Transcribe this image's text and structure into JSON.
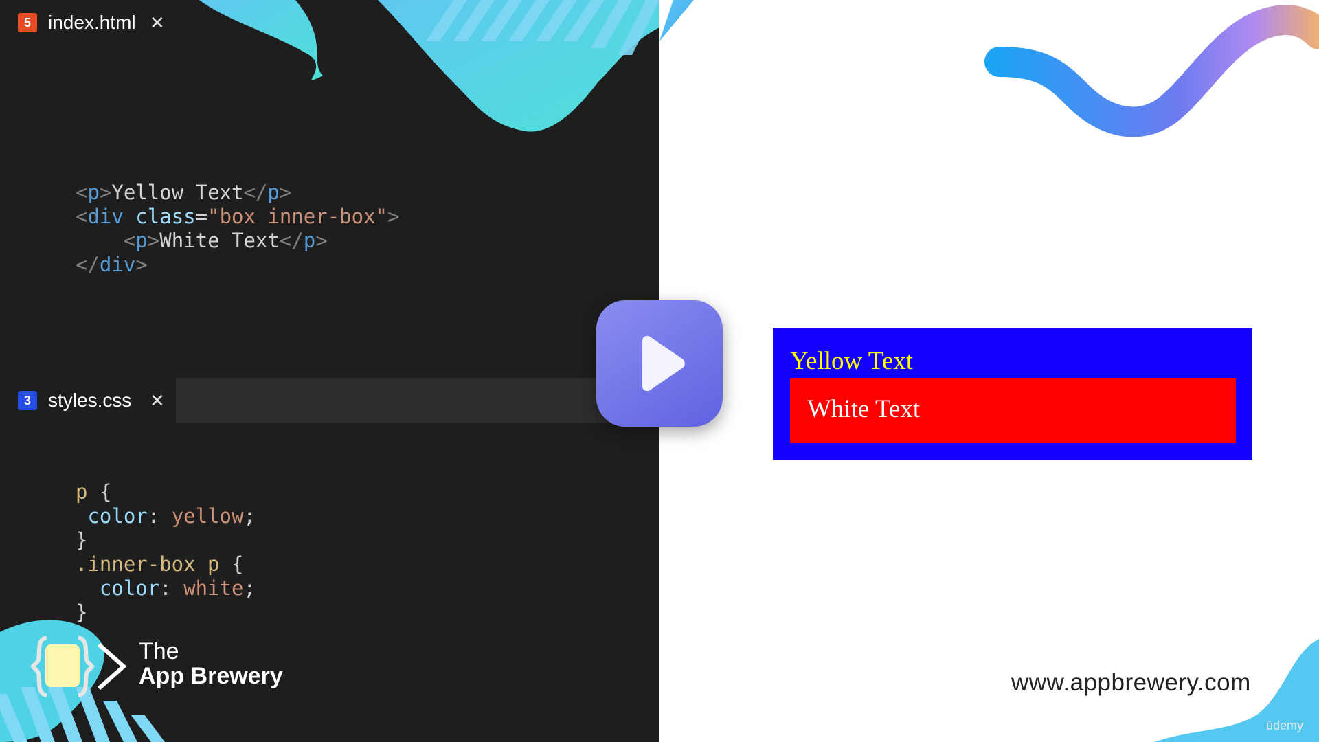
{
  "html_editor": {
    "tab_label": "index.html",
    "tab_icon": "html5-icon",
    "code_lines": [
      {
        "indent": "",
        "open_tag": "p",
        "text": "Yellow Text"
      },
      {
        "indent": "",
        "tag": "div",
        "attr": "class",
        "value": "\"box inner-box\""
      },
      {
        "indent": "    ",
        "open_tag": "p",
        "text": "White Text"
      },
      {
        "indent": "",
        "close_tag": "div"
      }
    ]
  },
  "css_editor": {
    "tab_label": "styles.css",
    "tab_icon": "css3-icon",
    "code_lines": [
      {
        "selector": "p",
        "brace": "{"
      },
      {
        "indent": " ",
        "prop": "color",
        "value": "yellow"
      },
      {
        "close": "}"
      },
      {
        "selector": ".inner-box p",
        "brace": "{"
      },
      {
        "indent": "  ",
        "prop": "color",
        "value": "white"
      },
      {
        "close": "}"
      }
    ]
  },
  "preview": {
    "yellow_text": "Yellow Text",
    "white_text": "White Text",
    "colors": {
      "outer_box": "#1400ff",
      "inner_box": "#ff0000",
      "yellow": "#ffff00",
      "white": "#ffffff"
    }
  },
  "branding": {
    "line1": "The",
    "line2": "App Brewery",
    "url": "www.appbrewery.com",
    "watermark": "ūdemy"
  },
  "play_button_icon": "play-icon",
  "colors": {
    "accent_cyan": "#4dd6e0",
    "accent_blue": "#3b82f6",
    "play": "#6e72e8"
  }
}
